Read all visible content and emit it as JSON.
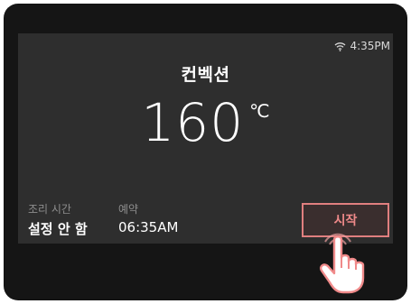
{
  "status": {
    "time": "4:35PM",
    "wifi_icon": "wifi-icon"
  },
  "mode": {
    "label": "컨벡션"
  },
  "temperature": {
    "value": "160",
    "unit": "℃"
  },
  "cook_time": {
    "label": "조리 시간",
    "value": "설정 안 함"
  },
  "reservation": {
    "label": "예약",
    "value": "06:35AM"
  },
  "start_button": {
    "label": "시작"
  },
  "colors": {
    "accent": "#e07f7f",
    "screen": "#2e2e2e",
    "bezel": "#151515"
  },
  "pointer_icon": "hand-pointer-icon"
}
